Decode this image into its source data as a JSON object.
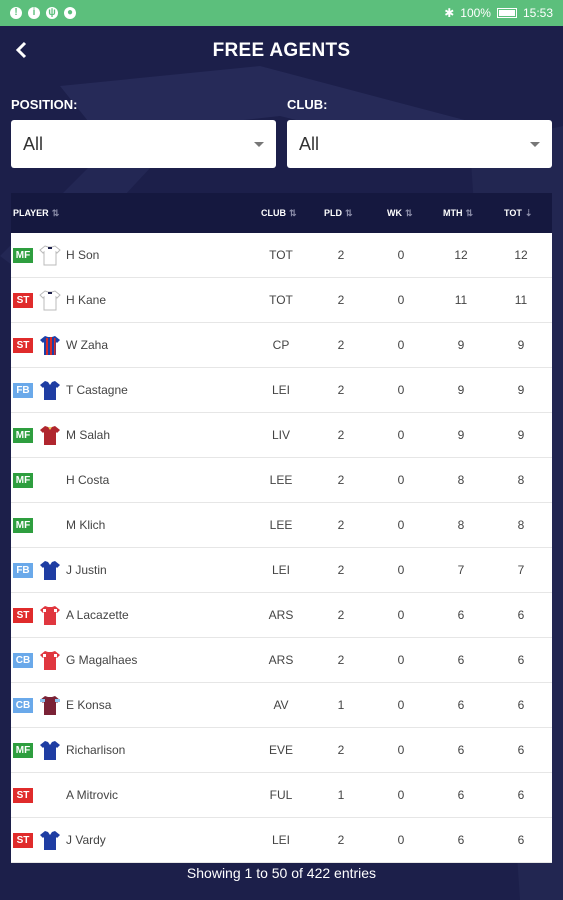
{
  "status_bar": {
    "battery": "100%",
    "time": "15:53"
  },
  "header": {
    "title": "FREE AGENTS",
    "back_icon": "chevron-left-icon"
  },
  "filters": {
    "position": {
      "label": "POSITION:",
      "value": "All"
    },
    "club": {
      "label": "CLUB:",
      "value": "All"
    }
  },
  "table": {
    "columns": {
      "player": "PLAYER",
      "club": "CLUB",
      "pld": "PLD",
      "wk": "WK",
      "mth": "MTH",
      "tot": "TOT"
    },
    "position_colors": {
      "MF": "#2e9e3f",
      "ST": "#e02b2b",
      "FB": "#6aa9ea",
      "CB": "#6aa9ea"
    },
    "rows": [
      {
        "pos": "MF",
        "name": "H Son",
        "club": "TOT",
        "pld": "2",
        "wk": "0",
        "mth": "12",
        "tot": "12",
        "kit": "white"
      },
      {
        "pos": "ST",
        "name": "H Kane",
        "club": "TOT",
        "pld": "2",
        "wk": "0",
        "mth": "11",
        "tot": "11",
        "kit": "white"
      },
      {
        "pos": "ST",
        "name": "W Zaha",
        "club": "CP",
        "pld": "2",
        "wk": "0",
        "mth": "9",
        "tot": "9",
        "kit": "stripes"
      },
      {
        "pos": "FB",
        "name": "T Castagne",
        "club": "LEI",
        "pld": "2",
        "wk": "0",
        "mth": "9",
        "tot": "9",
        "kit": "blue"
      },
      {
        "pos": "MF",
        "name": "M Salah",
        "club": "LIV",
        "pld": "2",
        "wk": "0",
        "mth": "9",
        "tot": "9",
        "kit": "red"
      },
      {
        "pos": "MF",
        "name": "H Costa",
        "club": "LEE",
        "pld": "2",
        "wk": "0",
        "mth": "8",
        "tot": "8",
        "kit": "none"
      },
      {
        "pos": "MF",
        "name": "M Klich",
        "club": "LEE",
        "pld": "2",
        "wk": "0",
        "mth": "8",
        "tot": "8",
        "kit": "none"
      },
      {
        "pos": "FB",
        "name": "J Justin",
        "club": "LEI",
        "pld": "2",
        "wk": "0",
        "mth": "7",
        "tot": "7",
        "kit": "blue"
      },
      {
        "pos": "ST",
        "name": "A Lacazette",
        "club": "ARS",
        "pld": "2",
        "wk": "0",
        "mth": "6",
        "tot": "6",
        "kit": "ars"
      },
      {
        "pos": "CB",
        "name": "G Magalhaes",
        "club": "ARS",
        "pld": "2",
        "wk": "0",
        "mth": "6",
        "tot": "6",
        "kit": "ars"
      },
      {
        "pos": "CB",
        "name": "E Konsa",
        "club": "AV",
        "pld": "1",
        "wk": "0",
        "mth": "6",
        "tot": "6",
        "kit": "claret"
      },
      {
        "pos": "MF",
        "name": "Richarlison",
        "club": "EVE",
        "pld": "2",
        "wk": "0",
        "mth": "6",
        "tot": "6",
        "kit": "blue"
      },
      {
        "pos": "ST",
        "name": "A Mitrovic",
        "club": "FUL",
        "pld": "1",
        "wk": "0",
        "mth": "6",
        "tot": "6",
        "kit": "none"
      },
      {
        "pos": "ST",
        "name": "J Vardy",
        "club": "LEI",
        "pld": "2",
        "wk": "0",
        "mth": "6",
        "tot": "6",
        "kit": "blue"
      }
    ]
  },
  "footer": {
    "text": "Showing 1 to 50 of 422 entries"
  }
}
